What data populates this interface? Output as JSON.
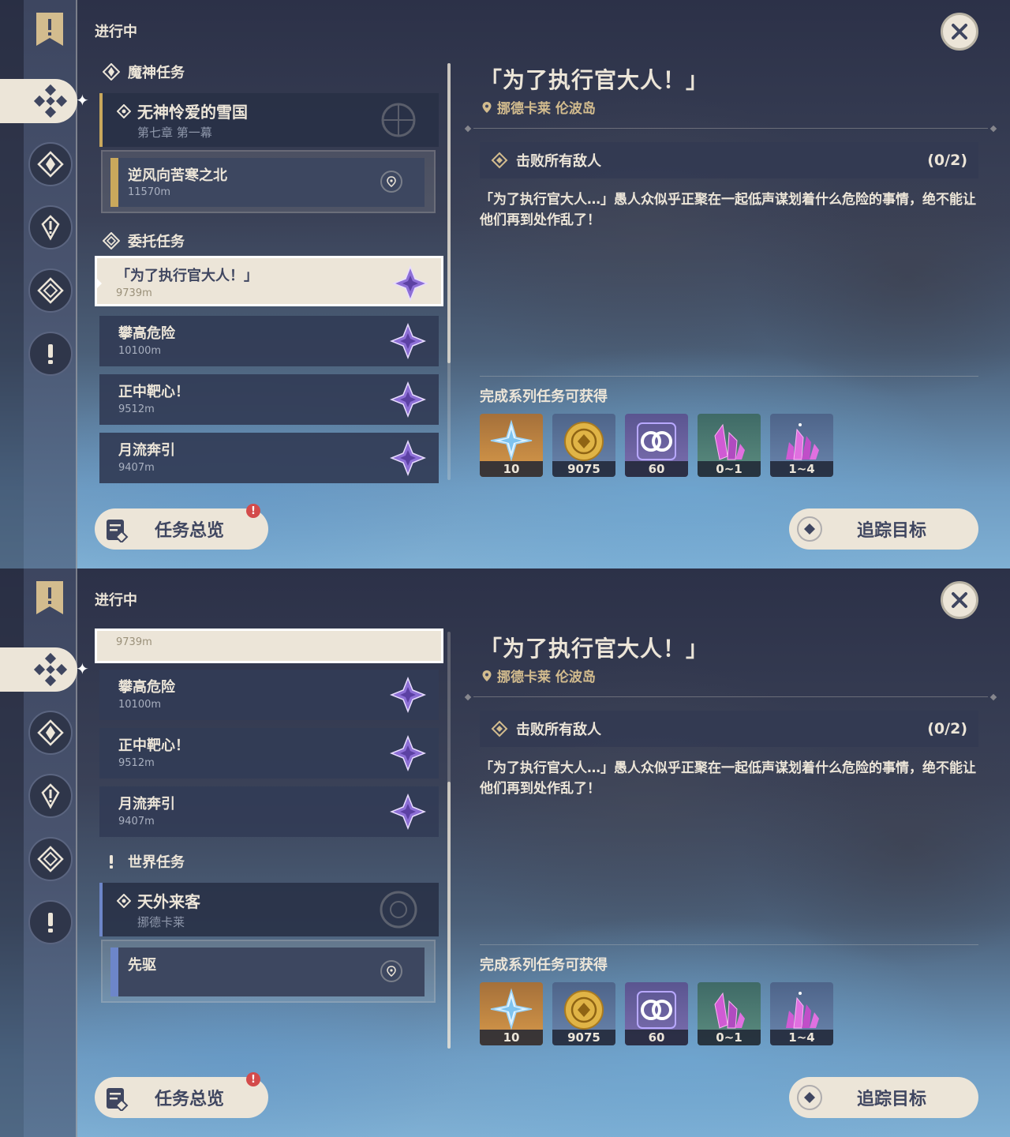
{
  "screens": [
    {
      "header_label": "进行中",
      "categories": {
        "archon": "魔神任务",
        "commission": "委托任务",
        "world": "世界任务"
      },
      "main_quest": {
        "title": "无神怜爱的雪国",
        "subtitle": "第七章 第一幕"
      },
      "sub_quest": {
        "title": "逆风向苦寒之北",
        "distance": "11570m"
      },
      "commissions": [
        {
          "title": "「为了执行官大人！」",
          "distance": "9739m"
        },
        {
          "title": "攀高危险",
          "distance": "10100m"
        },
        {
          "title": "正中靶心！",
          "distance": "9512m"
        },
        {
          "title": "月流奔引",
          "distance": "9407m"
        }
      ]
    },
    {
      "header_label": "进行中",
      "commissions": [
        {
          "title": "",
          "distance": "9739m"
        },
        {
          "title": "攀高危险",
          "distance": "10100m"
        },
        {
          "title": "正中靶心！",
          "distance": "9512m"
        },
        {
          "title": "月流奔引",
          "distance": "9407m"
        }
      ],
      "world_category": "世界任务",
      "world_quest": {
        "title": "天外来客",
        "subtitle": "挪德卡莱"
      },
      "world_sub_quest": {
        "title": "先驱"
      }
    }
  ],
  "detail": {
    "title": "「为了执行官大人！」",
    "location": "挪德卡莱 伦波岛",
    "objective": "击败所有敌人",
    "objective_count": "(0/2)",
    "description": "「为了执行官大人…」愚人众似乎正聚在一起低声谋划着什么危险的事情，绝不能让他们再到处作乱了！",
    "reward_label": "完成系列任务可获得",
    "rewards": [
      {
        "icon": "primogem-icon",
        "amount": "10"
      },
      {
        "icon": "mora-icon",
        "amount": "9075"
      },
      {
        "icon": "companionship-exp-icon",
        "amount": "60"
      },
      {
        "icon": "crystal-ore-icon",
        "amount": "0~1"
      },
      {
        "icon": "crystal-cluster-icon",
        "amount": "1~4"
      }
    ]
  },
  "buttons": {
    "overview": "任务总览",
    "overview_badge": "!",
    "track": "追踪目标"
  },
  "colors": {
    "cream": "#ece5d8",
    "archon_accent": "#c9a85c",
    "world_accent": "#6d86c9",
    "location_gold": "#d3bc8e",
    "badge_red": "#d34b4b"
  }
}
